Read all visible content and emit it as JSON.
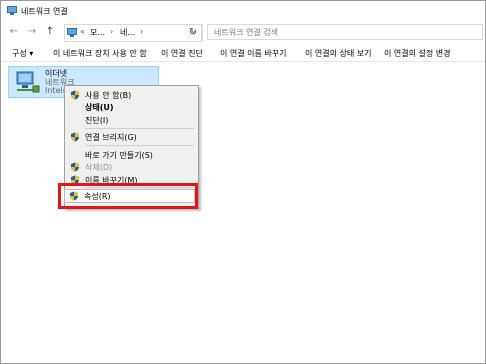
{
  "window": {
    "title": "네트워크 연결"
  },
  "nav": {
    "back": "←",
    "forward": "→",
    "up": "↑"
  },
  "address": {
    "overflow": "«",
    "crumb1": "모...",
    "sep1": "›",
    "crumb2": "네...",
    "sep2": "›",
    "dropdown": "⌄",
    "refresh": "↻"
  },
  "search": {
    "placeholder": "네트워크 연결 검색"
  },
  "commandbar": {
    "items": [
      "구성 ▾",
      "이 네트워크 장치 사용 안 함",
      "이 연결 진단",
      "이 연결 이름 바꾸기",
      "이 연결의 상태 보기",
      "이 연결의 설정 변경"
    ]
  },
  "adapter": {
    "name": "이더넷",
    "network": "네트워크",
    "device": "Intel(R)"
  },
  "context_menu": {
    "items": [
      {
        "label": "사용 안 함(B)",
        "shield": true
      },
      {
        "label": "상태(U)",
        "bold": true
      },
      {
        "label": "진단(I)"
      },
      {
        "label": "연결 브리지(G)",
        "shield": true
      },
      {
        "label": "바로 가기 만들기(S)"
      },
      {
        "label": "삭제(D)",
        "shield": true,
        "disabled": true
      },
      {
        "label": "이름 바꾸기(M)",
        "shield": true
      },
      {
        "label": "속성(R)",
        "shield": true
      }
    ]
  },
  "colors": {
    "highlight": "#e0161b",
    "selection": "#cce8ff"
  }
}
